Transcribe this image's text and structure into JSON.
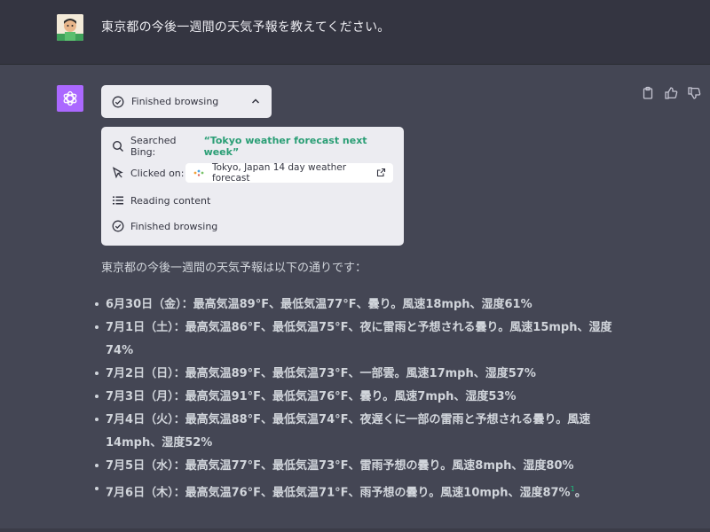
{
  "user": {
    "message": "東京都の今後一週間の天気予報を教えてください。",
    "avatar_icon": "user-photo-avatar"
  },
  "assistant": {
    "avatar_icon": "openai-logo-icon",
    "avatar_color": "#ab68ff",
    "actions": [
      "clipboard-icon",
      "thumbs-up-icon",
      "thumbs-down-icon"
    ],
    "browsing": {
      "toggle_label": "Finished browsing",
      "steps": {
        "searched_prefix": "Searched Bing: ",
        "searched_query": "“Tokyo weather forecast next week”",
        "clicked_prefix": "Clicked on:",
        "clicked_link": "Tokyo, Japan 14 day weather forecast",
        "reading": "Reading content",
        "finished": "Finished browsing"
      }
    },
    "intro": "東京都の今後一週間の天気予報は以下の通りです：",
    "forecast": [
      "6月30日（金）：最高気温89°F、最低気温77°F、曇り。風速18mph、湿度61%",
      "7月1日（土）：最高気温86°F、最低気温75°F、夜に雷雨と予想される曇り。風速15mph、湿度74%",
      "7月2日（日）：最高気温89°F、最低気温73°F、一部雲。風速17mph、湿度57%",
      "7月3日（月）：最高気温91°F、最低気温76°F、曇り。風速7mph、湿度53%",
      "7月4日（火）：最高気温88°F、最低気温74°F、夜遅くに一部の雷雨と予想される曇り。風速14mph、湿度52%",
      "7月5日（水）：最高気温77°F、最低気温73°F、雷雨予想の曇り。風速8mph、湿度80%",
      "7月6日（木）：最高気温76°F、最低気温71°F、雨予想の曇り。風速10mph、湿度87%"
    ],
    "citation": "1",
    "end_punct": "。"
  },
  "colors": {
    "page_bg": "#444654",
    "user_bg": "#343541",
    "panel_bg": "#ececf1",
    "query_green": "#2a9e75",
    "citation_green": "#19c37d"
  }
}
